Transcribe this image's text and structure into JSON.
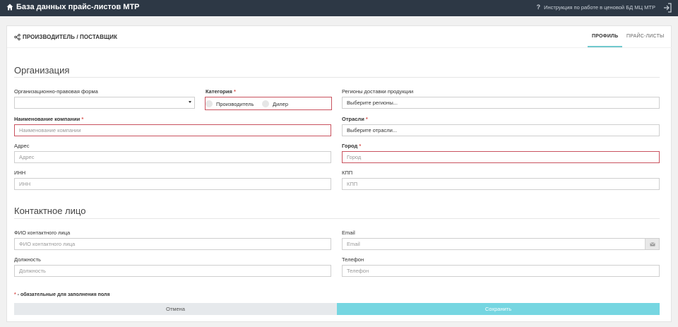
{
  "app": {
    "title": "База данных прайс-листов МТР",
    "help_link": "Инструкция по работе в ценовой БД МЦ МТР"
  },
  "card": {
    "title": "ПРОИЗВОДИТЕЛЬ / ПОСТАВЩИК"
  },
  "tabs": [
    {
      "label": "ПРОФИЛЬ",
      "active": true
    },
    {
      "label": "ПРАЙС-ЛИСТЫ",
      "active": false
    }
  ],
  "organization": {
    "title": "Организация",
    "legal_form": {
      "label": "Организационно-правовая форма",
      "value": ""
    },
    "category": {
      "label": "Категория",
      "required": "*",
      "options": [
        "Производитель",
        "Дилер"
      ]
    },
    "regions": {
      "label": "Регионы доставки продукции",
      "placeholder": "Выберите регионы..."
    },
    "company_name": {
      "label": "Наименование компании",
      "required": "*",
      "placeholder": "Наименование компании"
    },
    "industries": {
      "label": "Отрасли",
      "required": "*",
      "placeholder": "Выберите отрасли..."
    },
    "address": {
      "label": "Адрес",
      "placeholder": "Адрес"
    },
    "city": {
      "label": "Город",
      "required": "*",
      "placeholder": "Город"
    },
    "inn": {
      "label": "ИНН",
      "placeholder": "ИНН"
    },
    "kpp": {
      "label": "КПП",
      "placeholder": "КПП"
    }
  },
  "contact": {
    "title": "Контактное лицо",
    "full_name": {
      "label": "ФИО контактного лица",
      "placeholder": "ФИО контактного лица"
    },
    "email": {
      "label": "Email",
      "placeholder": "Email"
    },
    "position": {
      "label": "Должность",
      "placeholder": "Должность"
    },
    "phone": {
      "label": "Телефон",
      "placeholder": "Телефон"
    }
  },
  "footer": {
    "required_mark": "*",
    "required_note": " - обязательные для заполнения поля",
    "cancel": "Отмена",
    "save": "Сохранить"
  },
  "colors": {
    "topbar": "#2d3845",
    "accent": "#76d6e1",
    "error": "#c9535f",
    "required": "#d9534f"
  },
  "icons": {
    "brand": "home-icon",
    "help": "question-icon",
    "logout": "logout-icon",
    "title": "share-icon",
    "email": "envelope-icon"
  }
}
